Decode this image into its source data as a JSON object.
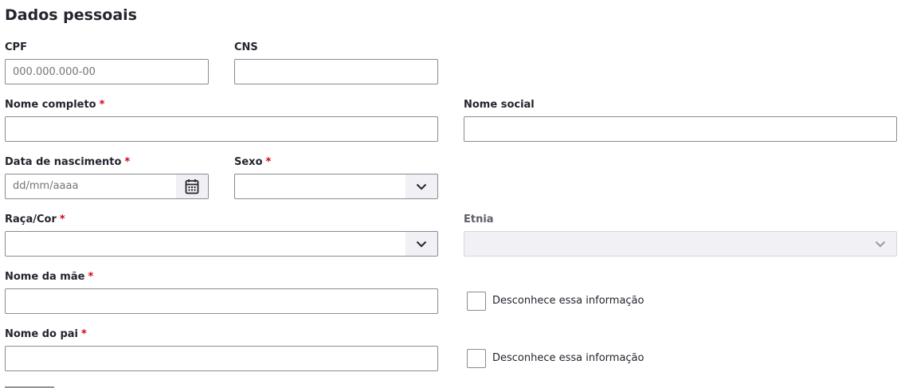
{
  "section": {
    "title": "Dados pessoais"
  },
  "required_mark": "*",
  "fields": {
    "cpf": {
      "label": "CPF",
      "placeholder": "000.000.000-00"
    },
    "cns": {
      "label": "CNS",
      "placeholder": ""
    },
    "nome_completo": {
      "label": "Nome completo",
      "required": true
    },
    "nome_social": {
      "label": "Nome social"
    },
    "data_nascimento": {
      "label": "Data de nascimento",
      "required": true,
      "placeholder": "dd/mm/aaaa"
    },
    "sexo": {
      "label": "Sexo",
      "required": true,
      "value": ""
    },
    "raca_cor": {
      "label": "Raça/Cor",
      "required": true,
      "value": ""
    },
    "etnia": {
      "label": "Etnia",
      "disabled": true,
      "value": ""
    },
    "nome_mae": {
      "label": "Nome da mãe",
      "required": true,
      "unknown_label": "Desconhece essa informação"
    },
    "nome_pai": {
      "label": "Nome do pai",
      "required": true,
      "unknown_label": "Desconhece essa informação"
    }
  },
  "icons": {
    "calendar": "calendar-icon",
    "chevron": "chevron-down-icon"
  },
  "colors": {
    "required": "#d0021b",
    "border": "#8a8a94",
    "button_bg": "#f0f0f5"
  }
}
